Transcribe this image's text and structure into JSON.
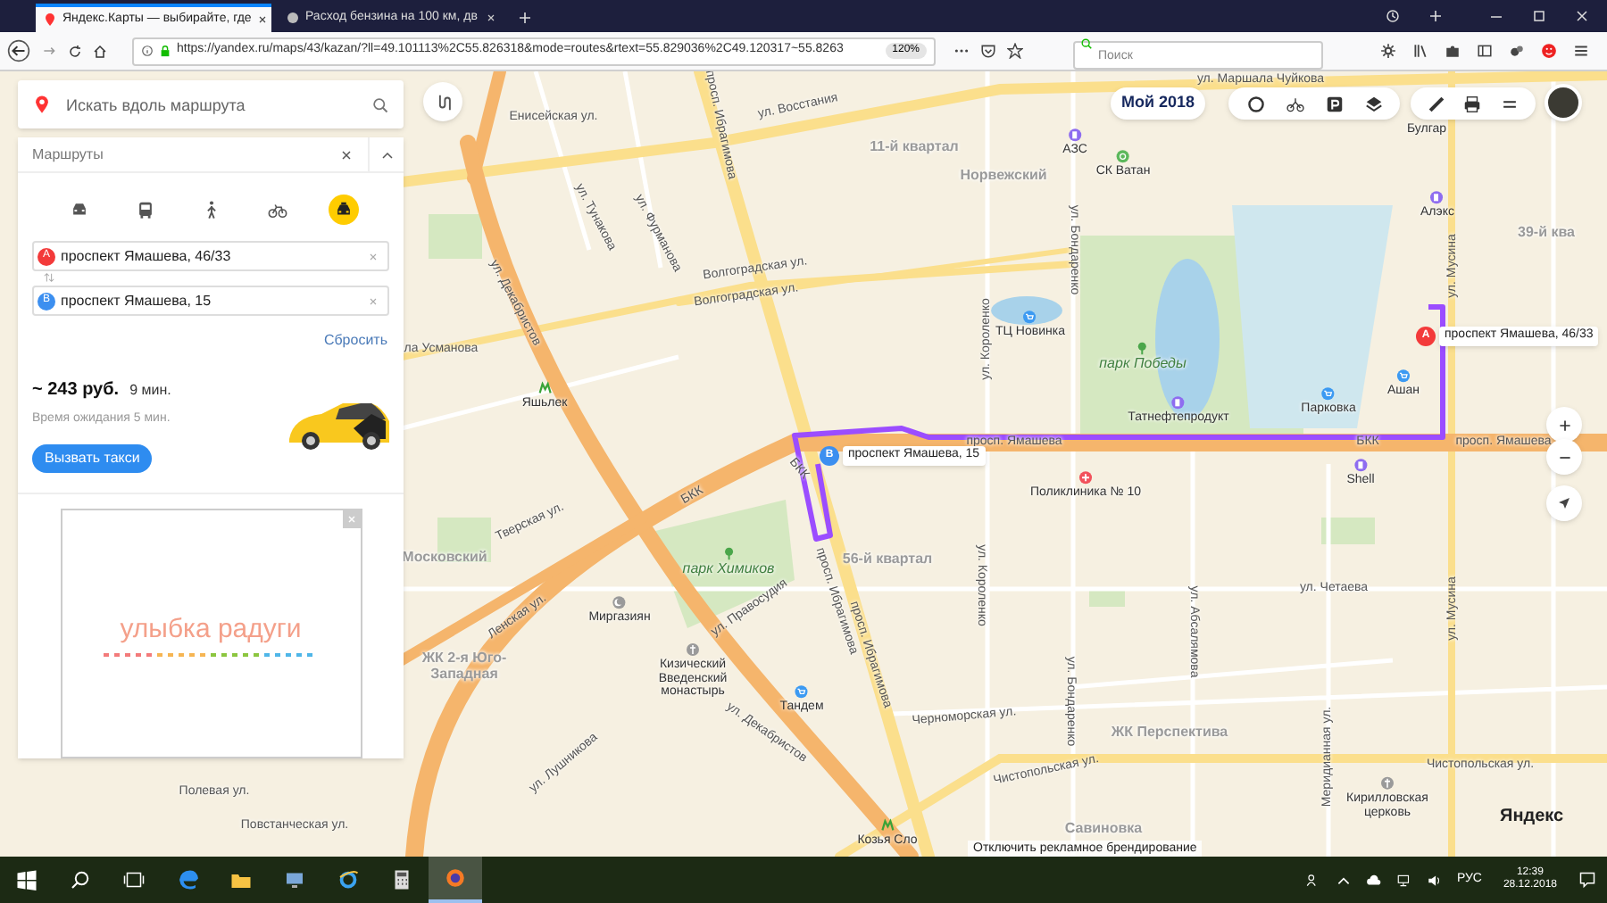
{
  "browser": {
    "tabs": [
      {
        "title": "Яндекс.Карты — выбирайте, где",
        "selected": true
      },
      {
        "title": "Расход бензина на 100 км, дв",
        "selected": false
      }
    ],
    "url": "https://yandex.ru/maps/43/kazan/?ll=49.101113%2C55.826318&mode=routes&rtext=55.829036%2C49.120317~55.8263",
    "zoom": "120%",
    "search": {
      "placeholder": "Поиск"
    }
  },
  "search": {
    "placeholder": "Искать вдоль маршрута"
  },
  "routes": {
    "title": "Маршруты",
    "modes": [
      {
        "kind": "car",
        "selected": false
      },
      {
        "kind": "bus",
        "selected": false
      },
      {
        "kind": "walk",
        "selected": false
      },
      {
        "kind": "bike",
        "selected": false
      },
      {
        "kind": "taxi",
        "selected": true
      }
    ],
    "points": [
      {
        "letter": "A",
        "value": "проспект Ямашева, 46/33"
      },
      {
        "letter": "B",
        "value": "проспект Ямашева, 15"
      }
    ],
    "reset": "Сбросить",
    "price": "~ 243 руб.",
    "duration": "9 мин.",
    "wait": "Время ожидания 5 мин.",
    "button": "Вызвать такси"
  },
  "ad": {
    "text": "улыбка радуги"
  },
  "map": {
    "badge": "Мой 2018",
    "labels": [
      {
        "text": "ул. Восстания",
        "kind": "street"
      },
      {
        "text": "Енисейская ул.",
        "kind": "street"
      },
      {
        "text": "просп. Ибрагимова",
        "kind": "street"
      },
      {
        "text": "11-й квартал",
        "kind": "district"
      },
      {
        "text": "Норвежский",
        "kind": "district"
      },
      {
        "text": "АЗС",
        "kind": "place"
      },
      {
        "text": "СК Ватан",
        "kind": "place"
      },
      {
        "text": "ул. Маршала Чуйкова",
        "kind": "street"
      },
      {
        "text": "Булгар",
        "kind": "place"
      },
      {
        "text": "Алэкс",
        "kind": "place"
      },
      {
        "text": "39-й ква",
        "kind": "district"
      },
      {
        "text": "ул. Тунакова",
        "kind": "street"
      },
      {
        "text": "ул. Фурманова",
        "kind": "street"
      },
      {
        "text": "Волгоградская ул.",
        "kind": "street"
      },
      {
        "text": "Волгоградская ул.",
        "kind": "street"
      },
      {
        "text": "ул. Декабристов",
        "kind": "street"
      },
      {
        "text": "ла Усманова",
        "kind": "street"
      },
      {
        "text": "Яшьлек",
        "kind": "place"
      },
      {
        "text": "ул. Короленко",
        "kind": "street"
      },
      {
        "text": "ул. Бондаренко",
        "kind": "street"
      },
      {
        "text": "ТЦ Новинка",
        "kind": "place"
      },
      {
        "text": "парк Победы",
        "kind": "park"
      },
      {
        "text": "Татнефтепродукт",
        "kind": "place"
      },
      {
        "text": "Парковка",
        "kind": "place"
      },
      {
        "text": "Ашан",
        "kind": "place"
      },
      {
        "text": "ул. Мусина",
        "kind": "street"
      },
      {
        "text": "просп. Ямашева",
        "kind": "street"
      },
      {
        "text": "БКК",
        "kind": "street"
      },
      {
        "text": "просп. Ямашева",
        "kind": "street"
      },
      {
        "text": "БКК",
        "kind": "street"
      },
      {
        "text": "Поликлиника № 10",
        "kind": "place"
      },
      {
        "text": "Shell",
        "kind": "place"
      },
      {
        "text": "Тверская ул.",
        "kind": "street"
      },
      {
        "text": "Московский",
        "kind": "district"
      },
      {
        "text": "БКК",
        "kind": "street"
      },
      {
        "text": "парк Химиков",
        "kind": "park"
      },
      {
        "text": "56-й квартал",
        "kind": "district"
      },
      {
        "text": "просп. Ибрагимова",
        "kind": "street"
      },
      {
        "text": "просп. Ибрагимова",
        "kind": "street"
      },
      {
        "text": "ул. Короленко",
        "kind": "street"
      },
      {
        "text": "ул. Четаева",
        "kind": "street"
      },
      {
        "text": "ул. Бондаренко",
        "kind": "street"
      },
      {
        "text": "ул. Абсалямова",
        "kind": "street"
      },
      {
        "text": "Меридианная ул.",
        "kind": "street"
      },
      {
        "text": "ул. Мусина",
        "kind": "street"
      },
      {
        "text": "Миргазиян",
        "kind": "place"
      },
      {
        "text": "Ленская ул.",
        "kind": "street"
      },
      {
        "text": "ул. Правосудия",
        "kind": "street"
      },
      {
        "text": "ЖК 2-я Юго-Западная",
        "kind": "district"
      },
      {
        "text": "Кизический Введенский монастырь",
        "kind": "place"
      },
      {
        "text": "Тандем",
        "kind": "place"
      },
      {
        "text": "ул. Декабристов",
        "kind": "street"
      },
      {
        "text": "ул. Лушникова",
        "kind": "street"
      },
      {
        "text": "Черноморская ул.",
        "kind": "street"
      },
      {
        "text": "ЖК Перспектива",
        "kind": "district"
      },
      {
        "text": "Чистопольская ул.",
        "kind": "street"
      },
      {
        "text": "Чистопольская ул.",
        "kind": "street"
      },
      {
        "text": "Кирилловская церковь",
        "kind": "place"
      },
      {
        "text": "Полевая ул.",
        "kind": "street"
      },
      {
        "text": "Повстанческая ул.",
        "kind": "street"
      },
      {
        "text": "Савиновка",
        "kind": "district"
      },
      {
        "text": "Козья Сло",
        "kind": "place"
      }
    ],
    "pins": [
      {
        "letter": "A",
        "label": "проспект Ямашева, 46/33"
      },
      {
        "letter": "B",
        "label": "проспект Ямашева, 15"
      }
    ],
    "branding_link": "Отключить рекламное брендирование",
    "logo": "Яндекс"
  },
  "taskbar": {
    "language": "РУС",
    "time": "12:39",
    "date": "28.12.2018"
  }
}
